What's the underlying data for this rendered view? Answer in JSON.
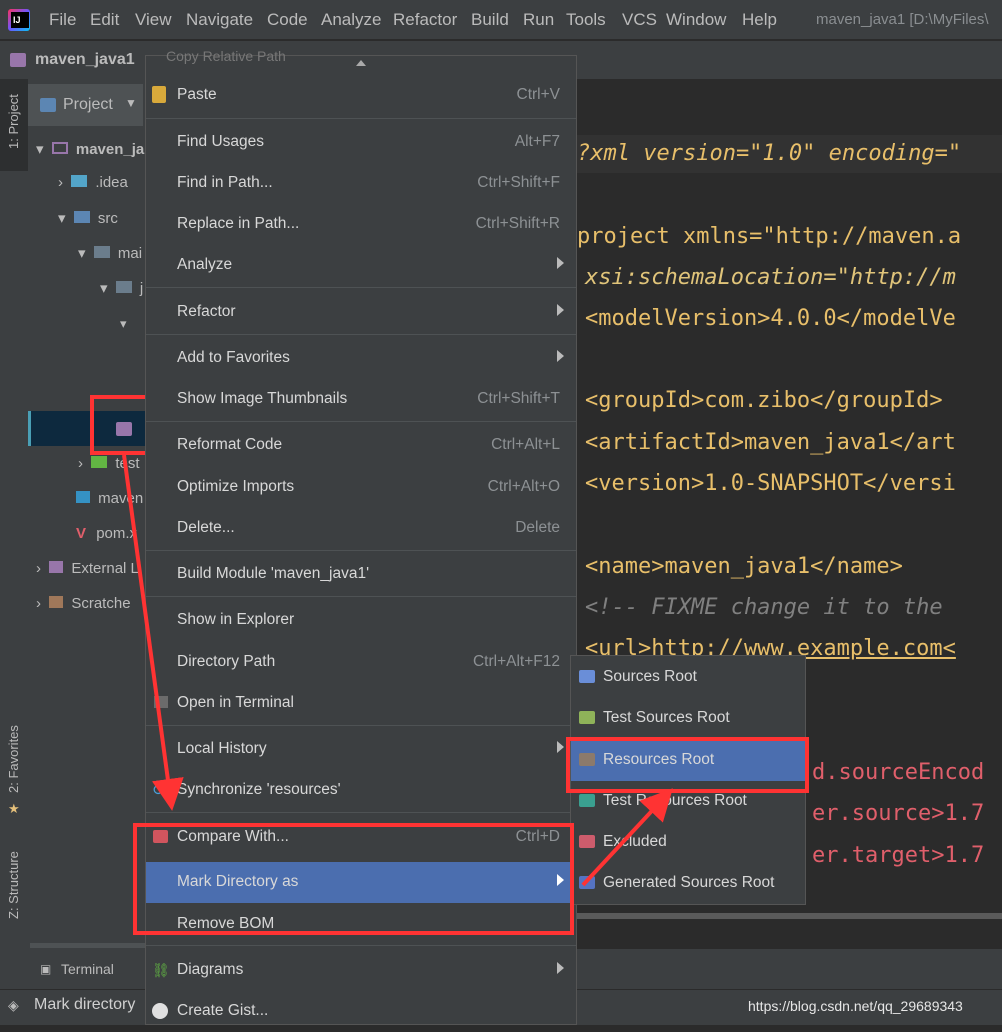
{
  "menubar": {
    "items": [
      "File",
      "Edit",
      "View",
      "Navigate",
      "Code",
      "Analyze",
      "Refactor",
      "Build",
      "Run",
      "Tools",
      "VCS",
      "Window",
      "Help"
    ],
    "title": "maven_java1 [D:\\MyFiles\\"
  },
  "navbar": {
    "project": "maven_java1"
  },
  "left_tabs": {
    "project": "1: Project",
    "favorites": "2: Favorites",
    "structure": "Z: Structure"
  },
  "project_panel": {
    "header": "Project",
    "tree": [
      ".idea",
      "src",
      "mai",
      "j",
      "test",
      "maven",
      "pom.x",
      "External L",
      "Scratche"
    ],
    "root": "maven_ja"
  },
  "context_menu": {
    "cut_off_top": "Copy Relative Path",
    "items": [
      {
        "label": "Paste",
        "shortcut": "Ctrl+V"
      },
      {
        "label": "Find Usages",
        "shortcut": "Alt+F7"
      },
      {
        "label": "Find in Path...",
        "shortcut": "Ctrl+Shift+F"
      },
      {
        "label": "Replace in Path...",
        "shortcut": "Ctrl+Shift+R"
      },
      {
        "label": "Analyze",
        "shortcut": ""
      },
      {
        "label": "Refactor",
        "shortcut": ""
      },
      {
        "label": "Add to Favorites",
        "shortcut": ""
      },
      {
        "label": "Show Image Thumbnails",
        "shortcut": "Ctrl+Shift+T"
      },
      {
        "label": "Reformat Code",
        "shortcut": "Ctrl+Alt+L"
      },
      {
        "label": "Optimize Imports",
        "shortcut": "Ctrl+Alt+O"
      },
      {
        "label": "Delete...",
        "shortcut": "Delete"
      },
      {
        "label": "Build Module 'maven_java1'",
        "shortcut": ""
      },
      {
        "label": "Show in Explorer",
        "shortcut": ""
      },
      {
        "label": "Directory Path",
        "shortcut": "Ctrl+Alt+F12"
      },
      {
        "label": "Open in Terminal",
        "shortcut": ""
      },
      {
        "label": "Local History",
        "shortcut": ""
      },
      {
        "label": "Synchronize 'resources'",
        "shortcut": ""
      },
      {
        "label": "Compare With...",
        "shortcut": "Ctrl+D"
      },
      {
        "label": "Mark Directory as",
        "shortcut": ""
      },
      {
        "label": "Remove BOM",
        "shortcut": ""
      },
      {
        "label": "Diagrams",
        "shortcut": ""
      },
      {
        "label": "Create Gist...",
        "shortcut": ""
      }
    ]
  },
  "submenu": {
    "items": [
      "Sources Root",
      "Test Sources Root",
      "Resources Root",
      "Test Resources Root",
      "Excluded",
      "Generated Sources Root"
    ]
  },
  "editor": {
    "lines": [
      "?xml version=\"1.0\" encoding=\"",
      "project xmlns=\"http://maven.a",
      "xsi:schemaLocation=\"http://m",
      "<modelVersion>4.0.0</modelVe",
      "<groupId>com.zibo</groupId>",
      "<artifactId>maven_java1</art",
      "<version>1.0-SNAPSHOT</versi",
      "<name>maven_java1</name>",
      "<!-- FIXME change it to the",
      "<url>http://www.example.com<",
      "d.sourceEncod",
      "er.source>1.7",
      "er.target>1.7"
    ]
  },
  "bottom": {
    "terminal": "Terminal",
    "status": "Mark directory"
  },
  "watermark": "https://blog.csdn.net/qq_29689343",
  "colors": {
    "highlight": "#4b6eaf",
    "annotation": "#ff3333"
  }
}
